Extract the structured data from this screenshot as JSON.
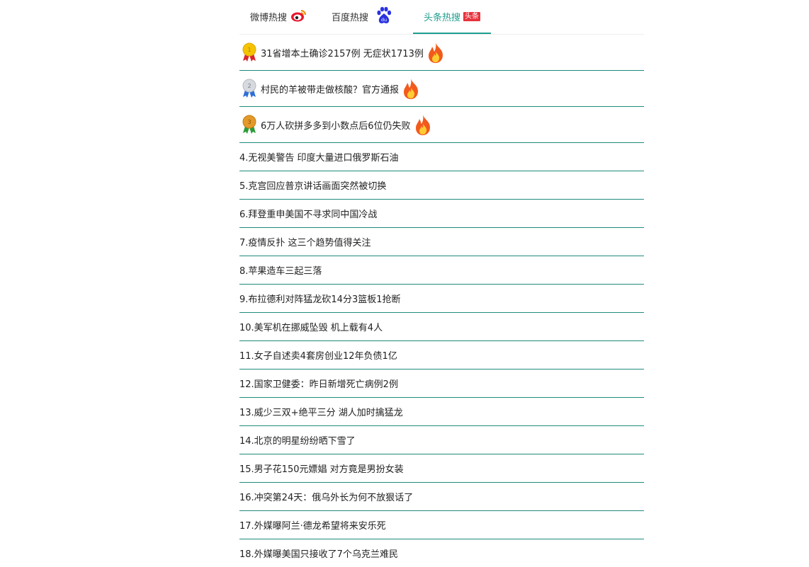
{
  "tabs": [
    {
      "label": "微博热搜",
      "icon": "weibo-logo-icon",
      "active": false
    },
    {
      "label": "百度热搜",
      "icon": "baidu-paw-icon",
      "active": false
    },
    {
      "label": "头条热搜",
      "badge": "头条",
      "icon": "toutiao-badge-icon",
      "active": true
    }
  ],
  "colors": {
    "accent": "#1f9e8f",
    "divider": "#1f8a7c",
    "gold": "#f5c400",
    "silver": "#c9ccd2",
    "bronze": "#e39a2a",
    "fire": "#f25a1d"
  },
  "top_items": [
    {
      "rank": 1,
      "medal": "gold-medal-icon",
      "title": "31省增本土确诊2157例 无症状1713例",
      "hot": true
    },
    {
      "rank": 2,
      "medal": "silver-medal-icon",
      "title": "村民的羊被带走做核酸？官方通报",
      "hot": true
    },
    {
      "rank": 3,
      "medal": "bronze-medal-icon",
      "title": "6万人砍拼多多到小数点后6位仍失败",
      "hot": true
    }
  ],
  "items": [
    {
      "text": "4.无视美警告 印度大量进口俄罗斯石油"
    },
    {
      "text": "5.克宫回应普京讲话画面突然被切换"
    },
    {
      "text": "6.拜登重申美国不寻求同中国冷战"
    },
    {
      "text": "7.疫情反扑 这三个趋势值得关注"
    },
    {
      "text": "8.苹果造车三起三落"
    },
    {
      "text": "9.布拉德利对阵猛龙砍14分3篮板1抢断"
    },
    {
      "text": "10.美军机在挪威坠毁 机上载有4人"
    },
    {
      "text": "11.女子自述卖4套房创业12年负债1亿"
    },
    {
      "text": "12.国家卫健委：昨日新增死亡病例2例"
    },
    {
      "text": "13.威少三双+绝平三分 湖人加时擒猛龙"
    },
    {
      "text": "14.北京的明星纷纷晒下雪了"
    },
    {
      "text": "15.男子花150元嫖娼 对方竟是男扮女装"
    },
    {
      "text": "16.冲突第24天：俄乌外长为何不放狠话了"
    },
    {
      "text": "17.外媒曝阿兰·德龙希望将来安乐死"
    },
    {
      "text": "18.外媒曝美国只接收了7个乌克兰难民"
    }
  ]
}
